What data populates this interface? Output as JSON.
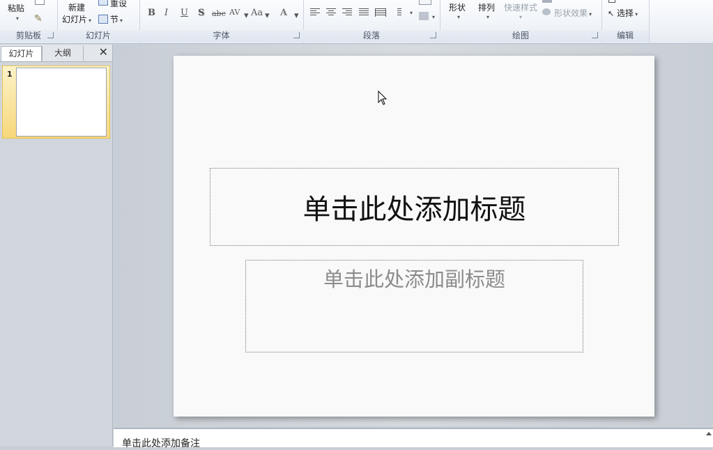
{
  "ribbon": {
    "clipboard": {
      "paste": "粘贴",
      "label": "剪贴板"
    },
    "slides": {
      "new_line1": "新建",
      "new_line2": "幻灯片",
      "reset": "重设",
      "section": "节",
      "label": "幻灯片"
    },
    "font": {
      "bold": "B",
      "italic": "I",
      "underline": "U",
      "shadow": "S",
      "strike": "abc",
      "spacing": "AV",
      "case": "Aa",
      "color": "A",
      "label": "字体"
    },
    "paragraph": {
      "label": "段落"
    },
    "drawing": {
      "shapes": "形状",
      "arrange": "排列",
      "quick_styles": "快速样式",
      "shape_effects": "形状效果",
      "label": "绘图"
    },
    "editing": {
      "select": "选择",
      "label": "编辑"
    }
  },
  "left_pane": {
    "tabs": [
      "幻灯片",
      "大纲"
    ],
    "slide_number": "1"
  },
  "slide": {
    "title_placeholder": "单击此处添加标题",
    "subtitle_placeholder": "单击此处添加副标题"
  },
  "notes": {
    "placeholder": "单击此处添加备注"
  }
}
